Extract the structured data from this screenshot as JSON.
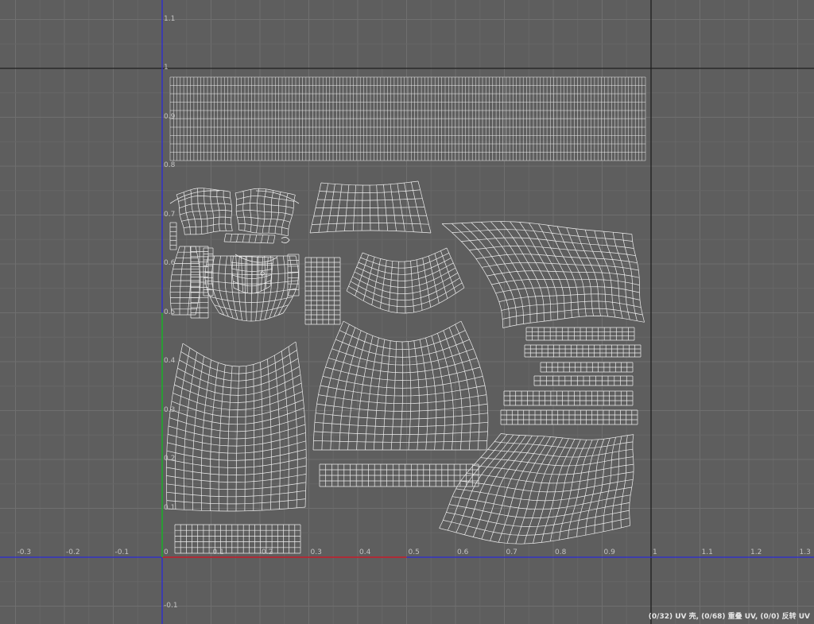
{
  "editor": {
    "name": "UV Editor",
    "colors": {
      "background": "#5e5e5e",
      "grid_minor": "#676767",
      "grid_major": "#6f6f6f",
      "u_axis": "#2a2ad8",
      "v_axis": "#2a2ad8",
      "u_unit_highlight": "#cc2020",
      "v_unit_highlight": "#22b022",
      "udim_boundary": "#1e1e1e",
      "wireframe": "#efefef"
    },
    "u_ticks": [
      "-0.3",
      "-0.2",
      "-0.1",
      "0",
      "0.1",
      "0.2",
      "0.3",
      "0.4",
      "0.5",
      "0.6",
      "0.7",
      "0.8",
      "0.9",
      "1",
      "1.1",
      "1.2",
      "1.3"
    ],
    "v_ticks": [
      "-0.1",
      "0.1",
      "0.2",
      "0.3",
      "0.4",
      "0.5",
      "0.6",
      "0.7",
      "0.8",
      "0.9",
      "1",
      "1.1"
    ]
  },
  "status": {
    "text": "(0/32) UV 壳, (0/68) 重叠 UV, (0/0) 反转 UV"
  }
}
